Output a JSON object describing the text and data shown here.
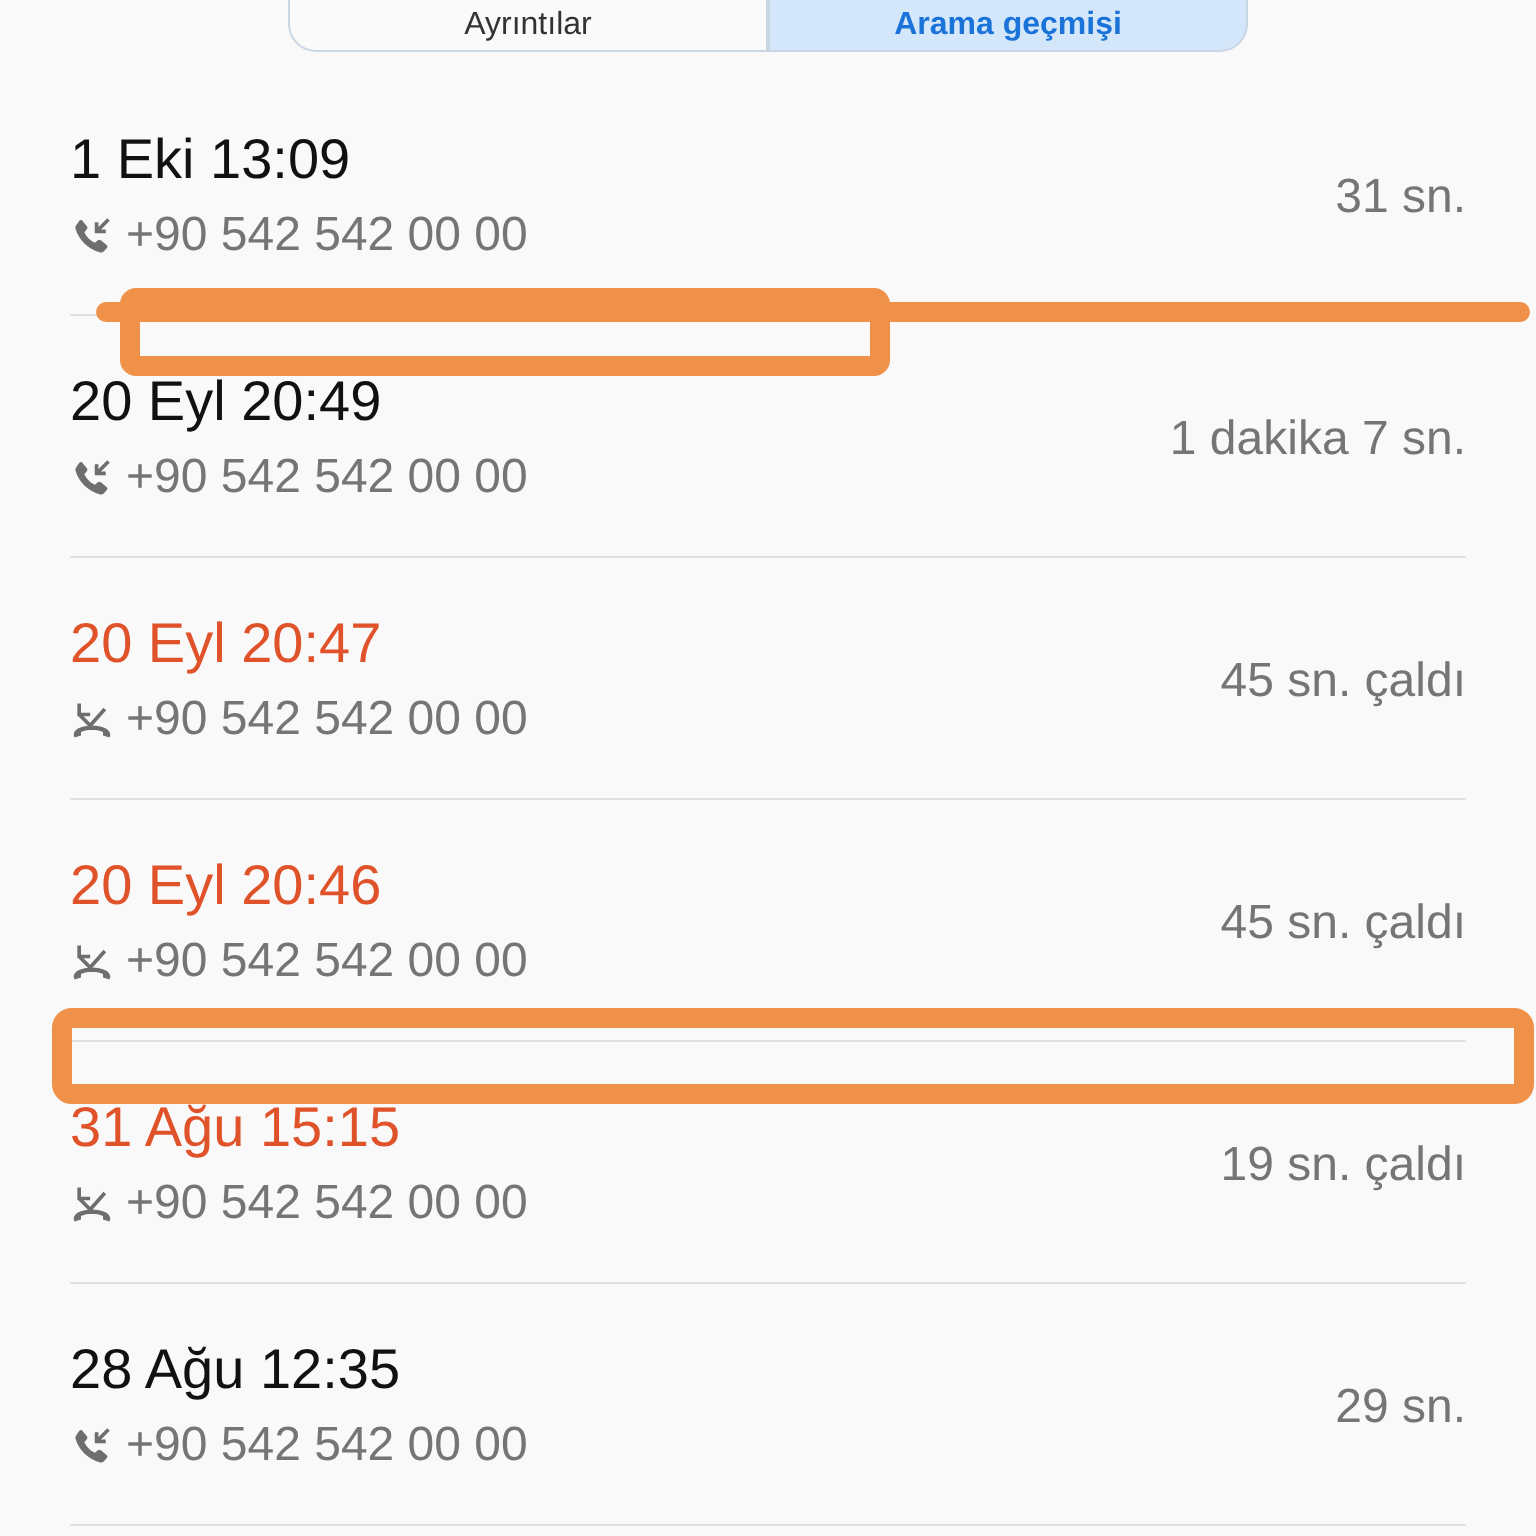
{
  "tabs": [
    {
      "label": "Ayrıntılar",
      "selected": false
    },
    {
      "label": "Arama geçmişi",
      "selected": true
    }
  ],
  "calls": [
    {
      "kind": "incoming",
      "date": "1 Eki 13:09",
      "number": "+90 542 542 00 00",
      "duration": "31 sn."
    },
    {
      "kind": "incoming",
      "date": "20 Eyl 20:49",
      "number": "+90 542 542 00 00",
      "duration": "1 dakika 7 sn."
    },
    {
      "kind": "missed",
      "date": "20 Eyl 20:47",
      "number": "+90 542 542 00 00",
      "duration": "45 sn. çaldı"
    },
    {
      "kind": "missed",
      "date": "20 Eyl 20:46",
      "number": "+90 542 542 00 00",
      "duration": "45 sn. çaldı"
    },
    {
      "kind": "missed",
      "date": "31 Ağu 15:15",
      "number": "+90 542 542 00 00",
      "duration": "19 sn. çaldı"
    },
    {
      "kind": "incoming",
      "date": "28 Ağu 12:35",
      "number": "+90 542 542 00 00",
      "duration": "29 sn."
    }
  ]
}
